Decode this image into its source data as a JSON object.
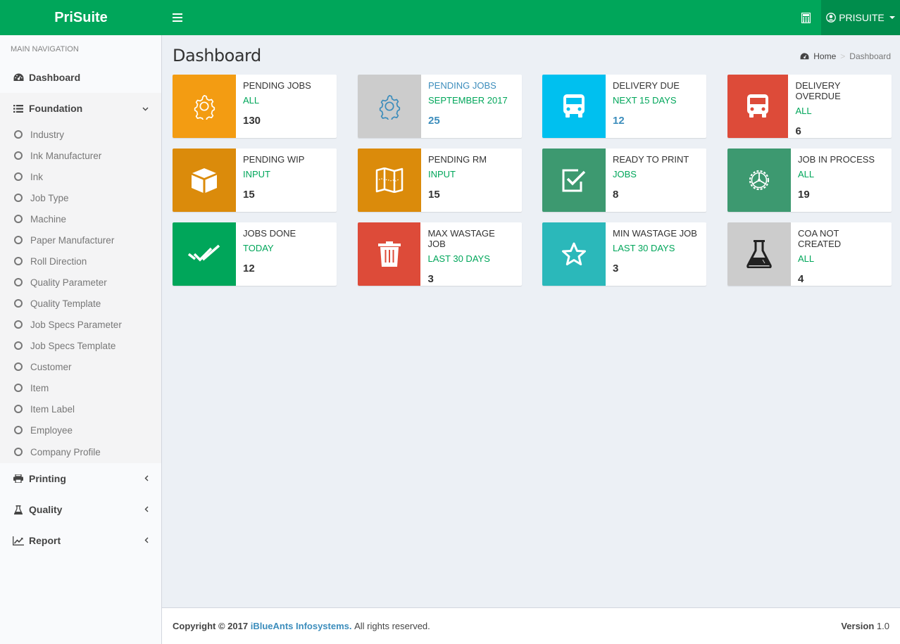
{
  "app": {
    "title": "PriSuite"
  },
  "header": {
    "user_label": "PRISUITE"
  },
  "sidebar": {
    "header": "MAIN NAVIGATION",
    "dashboard": "Dashboard",
    "foundation": {
      "label": "Foundation",
      "items": [
        "Industry",
        "Ink Manufacturer",
        "Ink",
        "Job Type",
        "Machine",
        "Paper Manufacturer",
        "Roll Direction",
        "Quality Parameter",
        "Quality Template",
        "Job Specs Parameter",
        "Job Specs Template",
        "Customer",
        "Item",
        "Item Label",
        "Employee",
        "Company Profile"
      ]
    },
    "printing": "Printing",
    "quality": "Quality",
    "report": "Report"
  },
  "page": {
    "title": "Dashboard",
    "breadcrumb": {
      "home": "Home",
      "current": "Dashboard"
    }
  },
  "boxes": [
    {
      "title": "PENDING JOBS",
      "sub": "ALL",
      "value": "130",
      "color": "#f39c12",
      "icon": "gear-icon"
    },
    {
      "title": "PENDING JOBS",
      "sub": "SEPTEMBER 2017",
      "value": "25",
      "color": "#cccccc",
      "icon": "gear-icon"
    },
    {
      "title": "DELIVERY DUE",
      "sub": "NEXT 15 DAYS",
      "value": "12",
      "color": "#00c0ef",
      "icon": "bus-icon"
    },
    {
      "title": "DELIVERY OVERDUE",
      "sub": "ALL",
      "value": "6",
      "color": "#dd4b39",
      "icon": "bus-icon"
    },
    {
      "title": "PENDING WIP",
      "sub": "INPUT",
      "value": "15",
      "color": "#db8b0b",
      "icon": "cube-icon"
    },
    {
      "title": "PENDING RM",
      "sub": "INPUT",
      "value": "15",
      "color": "#db8b0b",
      "icon": "map-icon"
    },
    {
      "title": "READY TO PRINT",
      "sub": "JOBS",
      "value": "8",
      "color": "#3d9970",
      "icon": "checkbox-icon"
    },
    {
      "title": "JOB IN PROCESS",
      "sub": "ALL",
      "value": "19",
      "color": "#3d9970",
      "icon": "cog-wheel-icon"
    },
    {
      "title": "JOBS DONE",
      "sub": "TODAY",
      "value": "12",
      "color": "#00a65a",
      "icon": "double-check-icon"
    },
    {
      "title": "MAX WASTAGE JOB",
      "sub": "LAST 30 DAYS",
      "value": "3",
      "color": "#dd4b39",
      "icon": "trash-icon"
    },
    {
      "title": "MIN WASTAGE JOB",
      "sub": "LAST 30 DAYS",
      "value": "3",
      "color": "#2bb8ba",
      "icon": "star-icon"
    },
    {
      "title": "COA NOT CREATED",
      "sub": "ALL",
      "value": "4",
      "color": "#cccccc",
      "icon": "flask-icon"
    }
  ],
  "footer": {
    "copyright": "Copyright © 2017",
    "company": "iBlueAnts Infosystems.",
    "rights": "All rights reserved.",
    "version_label": "Version",
    "version": "1.0"
  }
}
